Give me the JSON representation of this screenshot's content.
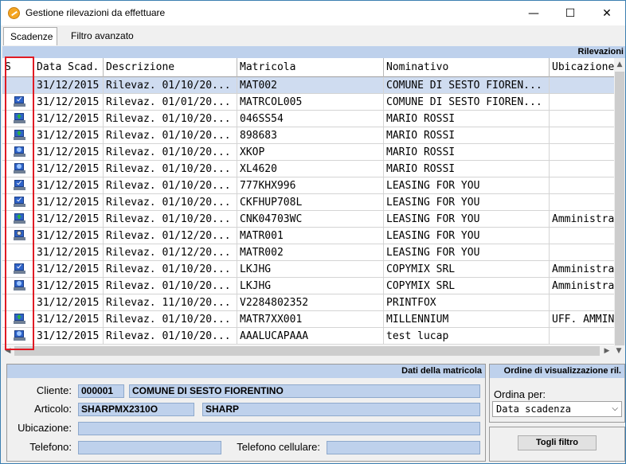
{
  "window": {
    "title": "Gestione rilevazioni da effettuare",
    "minimize": "—",
    "maximize": "☐",
    "close": "✕"
  },
  "tabs": [
    {
      "label": "Scadenze",
      "active": true
    },
    {
      "label": "Filtro avanzato",
      "active": false
    }
  ],
  "grid": {
    "band_title": "Rilevazioni",
    "columns": [
      "S",
      "Data Scad.",
      "Descrizione",
      "Matricola",
      "Nominativo",
      "Ubicazione"
    ],
    "rows": [
      {
        "icon": "none",
        "date": "31/12/2015",
        "desc": "Rilevaz. 01/10/20...",
        "matr": "MAT002",
        "nom": "COMUNE DI SESTO FIOREN...",
        "ubic": "",
        "selected": true
      },
      {
        "icon": "blue-ok",
        "date": "31/12/2015",
        "desc": "Rilevaz. 01/01/20...",
        "matr": "MATRCOL005",
        "nom": "COMUNE DI SESTO FIOREN...",
        "ubic": ""
      },
      {
        "icon": "green-up",
        "date": "31/12/2015",
        "desc": "Rilevaz. 01/10/20...",
        "matr": "046SS54",
        "nom": "MARIO ROSSI",
        "ubic": ""
      },
      {
        "icon": "green-up",
        "date": "31/12/2015",
        "desc": "Rilevaz. 01/10/20...",
        "matr": "898683",
        "nom": "MARIO ROSSI",
        "ubic": ""
      },
      {
        "icon": "blue-screen",
        "date": "31/12/2015",
        "desc": "Rilevaz. 01/10/20...",
        "matr": "XKOP",
        "nom": "MARIO ROSSI",
        "ubic": ""
      },
      {
        "icon": "blue-screen",
        "date": "31/12/2015",
        "desc": "Rilevaz. 01/10/20...",
        "matr": "XL4620",
        "nom": "MARIO ROSSI",
        "ubic": ""
      },
      {
        "icon": "blue-ok",
        "date": "31/12/2015",
        "desc": "Rilevaz. 01/10/20...",
        "matr": "777KHX996",
        "nom": "LEASING FOR YOU",
        "ubic": ""
      },
      {
        "icon": "blue-ok",
        "date": "31/12/2015",
        "desc": "Rilevaz. 01/10/20...",
        "matr": "CKFHUP708L",
        "nom": "LEASING FOR YOU",
        "ubic": ""
      },
      {
        "icon": "green-up",
        "date": "31/12/2015",
        "desc": "Rilevaz. 01/10/20...",
        "matr": "CNK04703WC",
        "nom": "LEASING FOR YOU",
        "ubic": "Amministra"
      },
      {
        "icon": "gear",
        "date": "31/12/2015",
        "desc": "Rilevaz. 01/12/20...",
        "matr": "MATR001",
        "nom": "LEASING FOR YOU",
        "ubic": ""
      },
      {
        "icon": "none",
        "date": "31/12/2015",
        "desc": "Rilevaz. 01/12/20...",
        "matr": "MATR002",
        "nom": "LEASING FOR YOU",
        "ubic": ""
      },
      {
        "icon": "blue-ok",
        "date": "31/12/2015",
        "desc": "Rilevaz. 01/10/20...",
        "matr": "LKJHG",
        "nom": "COPYMIX SRL",
        "ubic": "Amministra"
      },
      {
        "icon": "blue-screen",
        "date": "31/12/2015",
        "desc": "Rilevaz. 01/10/20...",
        "matr": "LKJHG",
        "nom": "COPYMIX SRL",
        "ubic": "Amministra"
      },
      {
        "icon": "none",
        "date": "31/12/2015",
        "desc": "Rilevaz. 11/10/20...",
        "matr": "V2284802352",
        "nom": "PRINTFOX",
        "ubic": ""
      },
      {
        "icon": "green-up",
        "date": "31/12/2015",
        "desc": "Rilevaz. 01/10/20...",
        "matr": "MATR7XX001",
        "nom": "MILLENNIUM",
        "ubic": "UFF. AMMIN"
      },
      {
        "icon": "blue-screen",
        "date": "31/12/2015",
        "desc": "Rilevaz. 01/10/20...",
        "matr": "AAALUCAPAAA",
        "nom": "test lucap",
        "ubic": ""
      }
    ]
  },
  "details": {
    "title": "Dati della matricola",
    "cliente_label": "Cliente:",
    "cliente_code": "000001",
    "cliente_name": "COMUNE DI SESTO FIORENTINO",
    "articolo_label": "Articolo:",
    "articolo_code": "SHARPMX2310O",
    "articolo_brand": "SHARP",
    "ubicazione_label": "Ubicazione:",
    "ubicazione": "",
    "telefono_label": "Telefono:",
    "telefono": "",
    "cellulare_label": "Telefono cellulare:",
    "cellulare": ""
  },
  "order": {
    "title": "Ordine di visualizzazione ril.",
    "label": "Ordina per:",
    "selected": "Data scadenza"
  },
  "filter": {
    "button": "Togli filtro"
  },
  "colors": {
    "header_band": "#bed1ec",
    "selected_row": "#cfdcf0",
    "highlight_box": "#e01b24"
  }
}
